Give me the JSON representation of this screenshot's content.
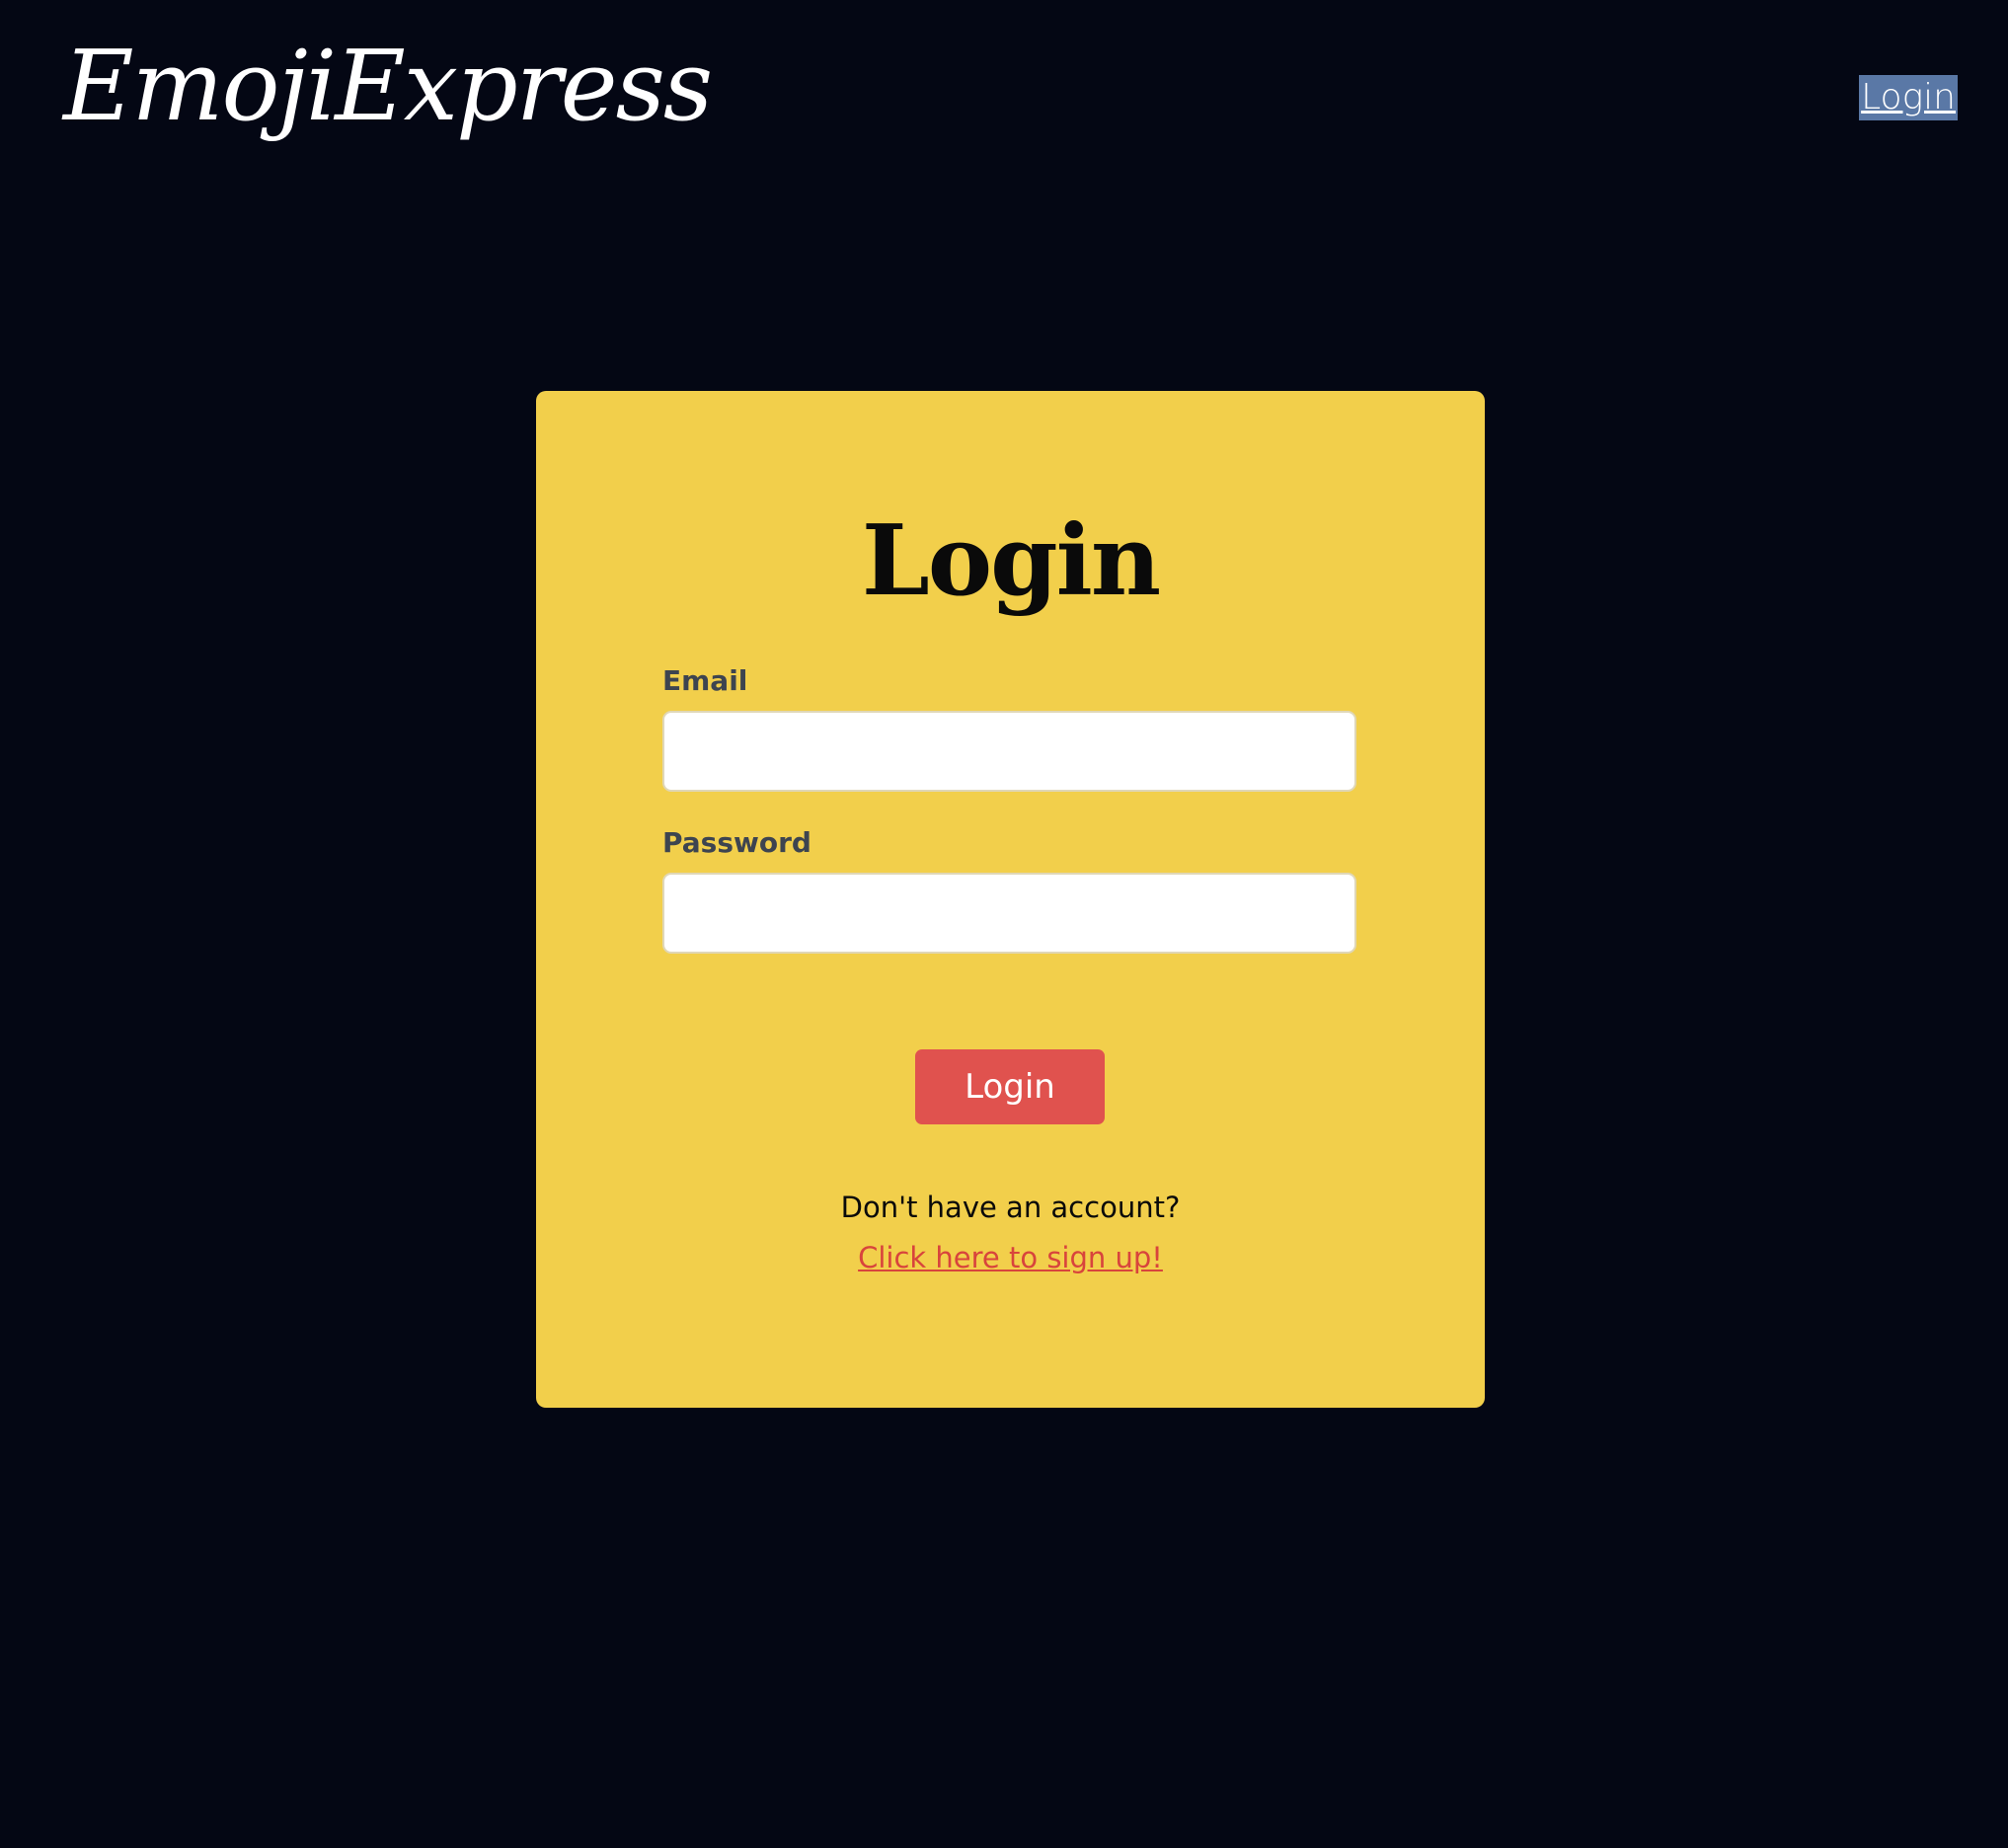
{
  "header": {
    "brand": "EmojiExpress",
    "nav_login": "Login"
  },
  "card": {
    "title": "Login",
    "email_label": "Email",
    "email_value": "",
    "password_label": "Password",
    "password_value": "",
    "submit_label": "Login",
    "no_account_text": "Don't have an account?",
    "signup_link": "Click here to sign up!"
  },
  "colors": {
    "background": "#040714",
    "card": "#f2cf4b",
    "button": "#e0524e",
    "link": "#d8443c",
    "nav_highlight": "#5a78a6"
  }
}
